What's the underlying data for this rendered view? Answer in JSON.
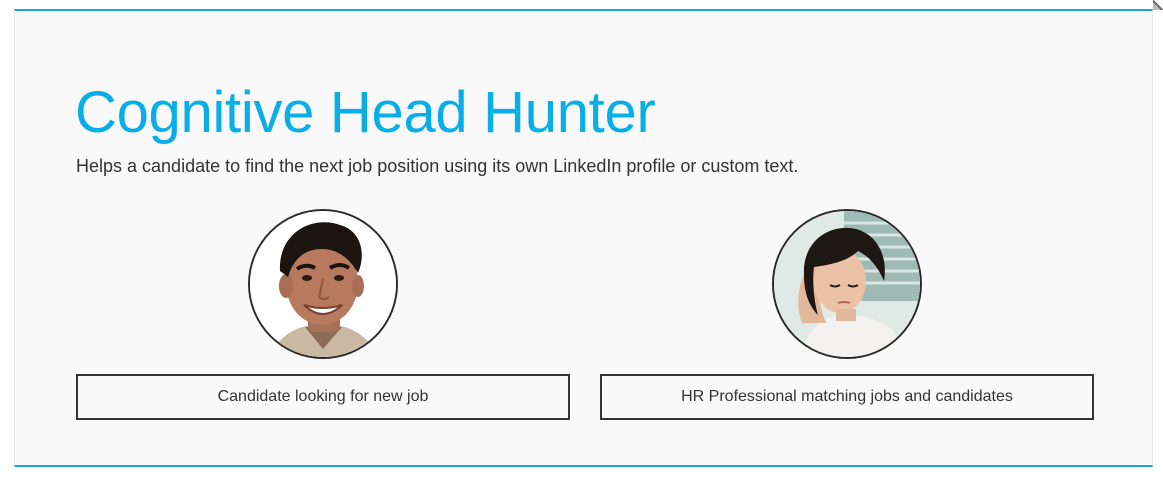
{
  "header": {
    "title": "Cognitive Head Hunter",
    "subtitle": "Helps a candidate to find the next job position using its own LinkedIn profile or custom text."
  },
  "options": [
    {
      "label": "Candidate looking for new job",
      "photo": "candidate-photo"
    },
    {
      "label": "HR Professional matching jobs and candidates",
      "photo": "hr-professional-photo"
    }
  ],
  "colors": {
    "accent": "#08aee8",
    "rule": "#1aa3dd",
    "panel_background": "#f9f9f9",
    "text": "#333333"
  }
}
